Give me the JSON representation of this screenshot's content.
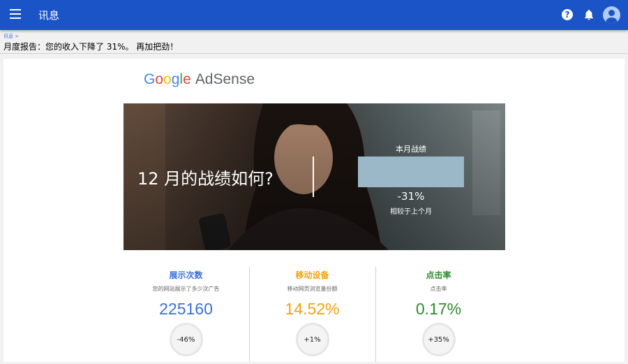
{
  "appbar": {
    "title": "讯息",
    "menu_icon": "menu-icon",
    "help_icon": "help-icon",
    "bell_icon": "bell-icon",
    "avatar_icon": "account-avatar",
    "color": "#1a54c6"
  },
  "breadcrumb": {
    "root": "讯息",
    "separator": ">"
  },
  "message": {
    "subject": "月度报告：您的收入下降了 31%。 再加把劲！"
  },
  "email": {
    "logo": {
      "google": [
        "G",
        "o",
        "o",
        "g",
        "l",
        "e"
      ],
      "product": "AdSense",
      "colors": [
        "#4285f4",
        "#ea4335",
        "#fbbc05",
        "#4285f4",
        "#34a853",
        "#ea4335"
      ]
    },
    "banner": {
      "question": "12 月的战绩如何?",
      "performance_label": "本月战绩",
      "performance_value": "-31%",
      "performance_sub": "相较于上个月"
    },
    "metrics": [
      {
        "title": "展示次数",
        "desc": "您的网站展示了多少次广告",
        "value": "225160",
        "change": "-46%",
        "color": "#3a6fd8"
      },
      {
        "title": "移动设备",
        "desc": "移动网页浏览量份额",
        "value": "14.52%",
        "change": "+1%",
        "color": "#f2a20c"
      },
      {
        "title": "点击率",
        "desc": "点击率",
        "value": "0.17%",
        "change": "+35%",
        "color": "#2e8b2e"
      }
    ]
  }
}
